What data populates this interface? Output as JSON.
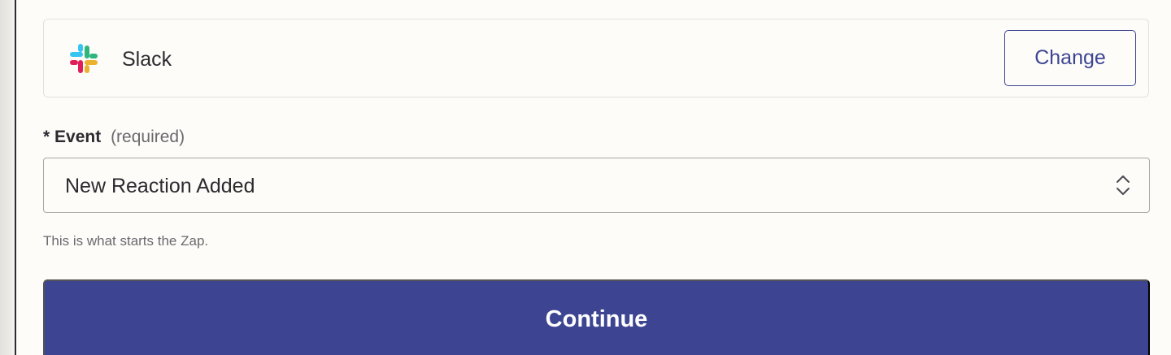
{
  "app": {
    "name": "Slack",
    "logo_icon": "slack-logo-icon",
    "change_label": "Change"
  },
  "event": {
    "required_marker": "*",
    "label": "Event",
    "required_text": "(required)",
    "value": "New Reaction Added",
    "helper": "This is what starts the Zap."
  },
  "actions": {
    "continue_label": "Continue"
  },
  "colors": {
    "primary": "#3d4592",
    "background": "#fdfcf9",
    "slack_blue": "#36c5f0",
    "slack_green": "#2eb67d",
    "slack_yellow": "#ecb22e",
    "slack_red": "#e01e5a"
  }
}
